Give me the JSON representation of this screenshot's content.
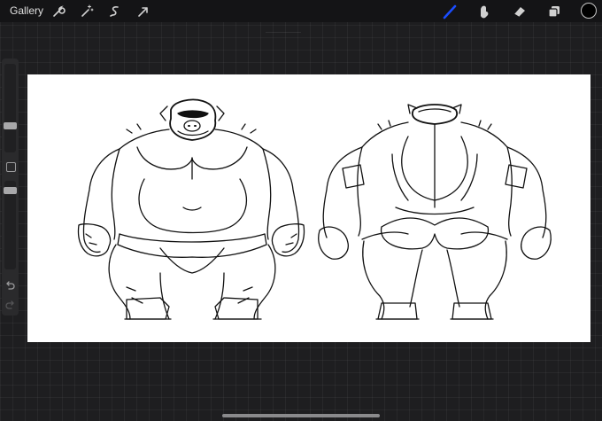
{
  "topbar": {
    "gallery_label": "Gallery",
    "left_tools": [
      "wrench-icon",
      "magic-wand-icon",
      "selection-icon",
      "transform-arrow-icon"
    ],
    "right_tools": [
      "brush-icon",
      "smudge-icon",
      "eraser-icon",
      "layers-icon"
    ],
    "active_tool": "brush-icon",
    "active_color": "#0a3cff",
    "current_color": "#000000"
  },
  "sidebar": {
    "brush_size": 0.28,
    "brush_opacity": 0.55,
    "controls": [
      "modify-button",
      "undo-icon",
      "redo-icon"
    ]
  },
  "canvas": {
    "background": "#ffffff",
    "content": [
      "character-front-view",
      "character-back-view"
    ]
  }
}
